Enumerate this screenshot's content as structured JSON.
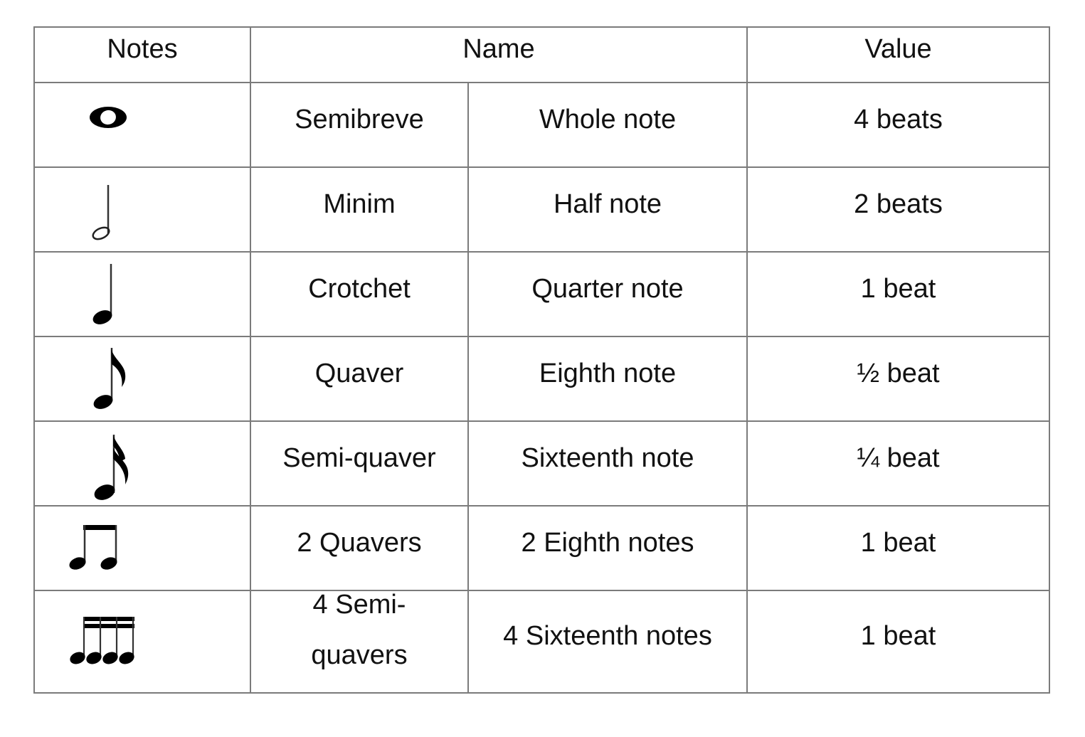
{
  "table": {
    "headers": {
      "notes": "Notes",
      "name": "Name",
      "value": "Value"
    },
    "rows": [
      {
        "symbol": "whole-note-icon",
        "british": "Semibreve",
        "american": "Whole note",
        "value": "4 beats"
      },
      {
        "symbol": "half-note-icon",
        "british": "Minim",
        "american": "Half note",
        "value": "2 beats"
      },
      {
        "symbol": "quarter-note-icon",
        "british": "Crotchet",
        "american": "Quarter note",
        "value": "1 beat"
      },
      {
        "symbol": "eighth-note-icon",
        "british": "Quaver",
        "american": "Eighth note",
        "value": "½ beat"
      },
      {
        "symbol": "sixteenth-note-icon",
        "british": "Semi-quaver",
        "american": "Sixteenth note",
        "value": "¼ beat"
      },
      {
        "symbol": "beamed-eighth-notes-icon",
        "british": "2 Quavers",
        "american": "2 Eighth notes",
        "value": "1 beat"
      },
      {
        "symbol": "beamed-sixteenth-notes-icon",
        "british_line1": "4 Semi-",
        "british_line2": "quavers",
        "american": "4 Sixteenth notes",
        "value": "1 beat"
      }
    ]
  }
}
